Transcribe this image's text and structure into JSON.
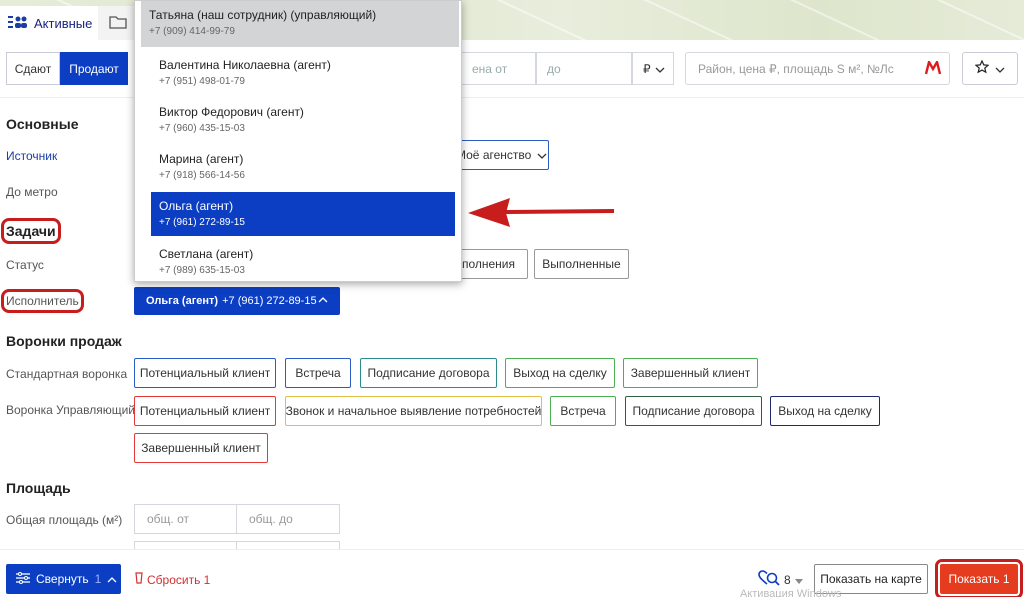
{
  "tabs": {
    "active_label": "Активные"
  },
  "toolbar": {
    "rent": "Сдают",
    "sell": "Продают",
    "price_from_ph": "ена от",
    "price_to_ph": "до",
    "currency": "₽",
    "search_ph": "Район, цена ₽, площадь S м², №Лс"
  },
  "sections": {
    "main": "Основные",
    "source": "Источник",
    "metro": "До метро",
    "tasks": "Задачи",
    "status": "Статус",
    "executor": "Исполнитель",
    "funnels": "Воронки продаж",
    "std_funnel": "Стандартная воронка",
    "mgr_funnel": "Воронка Управляющий",
    "area": "Площадь",
    "total_area": "Общая площадь (м²)"
  },
  "source_dropdown": "Моё агенство",
  "status_chips": [
    "ыполнения",
    "Выполненные"
  ],
  "executor": {
    "name": "Ольга (агент)",
    "phone": "+7 (961) 272-89-15"
  },
  "std_funnel_chips": [
    "Потенциальный клиент",
    "Встреча",
    "Подписание договора",
    "Выход на сделку",
    "Завершенный клиент"
  ],
  "mgr_funnel_chips": [
    "Потенциальный клиент",
    "Звонок и начальное выявление потребностей",
    "Встреча",
    "Подписание договора",
    "Выход на сделку",
    "Завершенный клиент"
  ],
  "area": {
    "from_ph": "общ. от",
    "to_ph": "общ. до"
  },
  "dropdown": [
    {
      "name": "Татьяна (наш сотрудник) (управляющий)",
      "phone": "+7 (909) 414-99-79"
    },
    {
      "name": "Валентина Николаевна (агент)",
      "phone": "+7 (951) 498-01-79"
    },
    {
      "name": "Виктор Федорович (агент)",
      "phone": "+7 (960) 435-15-03"
    },
    {
      "name": "Марина (агент)",
      "phone": "+7 (918) 566-14-56"
    },
    {
      "name": "Ольга (агент)",
      "phone": "+7 (961) 272-89-15"
    },
    {
      "name": "Светлана (агент)",
      "phone": "+7 (989) 635-15-03"
    }
  ],
  "bottom": {
    "collapse": "Свернуть",
    "collapse_count": "1",
    "reset": "Сбросить 1",
    "fav_count": "8",
    "map": "Показать на карте",
    "show": "Показать 1",
    "ghost": "Активация Windows"
  },
  "colors": {
    "accent": "#0b3ec2",
    "danger": "#e53b1f",
    "annotation": "#c81d1d"
  }
}
